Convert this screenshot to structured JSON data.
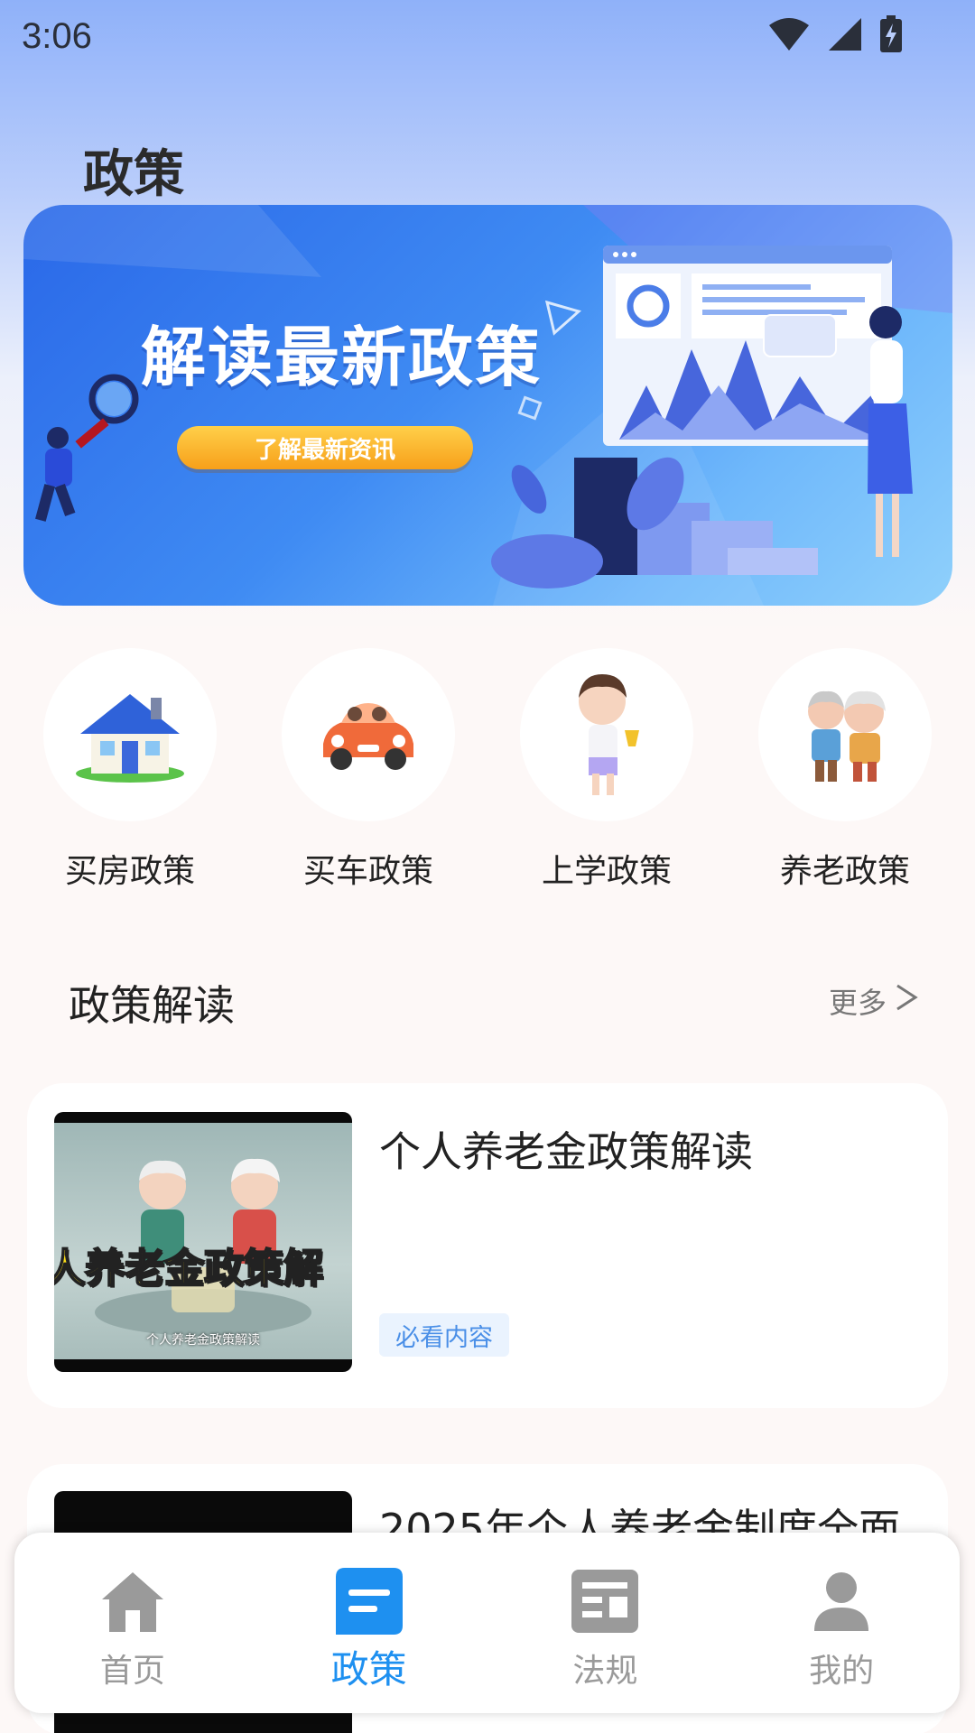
{
  "status_bar": {
    "time": "3:06"
  },
  "page": {
    "title": "政策"
  },
  "banner": {
    "title": "解读最新政策",
    "button_label": "了解最新资讯"
  },
  "categories": [
    {
      "label": "买房政策",
      "icon": "house-icon"
    },
    {
      "label": "买车政策",
      "icon": "car-icon"
    },
    {
      "label": "上学政策",
      "icon": "student-icon"
    },
    {
      "label": "养老政策",
      "icon": "elderly-couple-icon"
    }
  ],
  "section": {
    "title": "政策解读",
    "more_label": "更多"
  },
  "articles": [
    {
      "title": "个人养老金政策解读",
      "tag": "必看内容",
      "thumbnail_title": "人养老金政策解",
      "thumbnail_caption": "个人养老金政策解读"
    },
    {
      "title": "2025年个人养老金制度全面"
    }
  ],
  "bottom_nav": [
    {
      "label": "首页",
      "icon": "home-icon",
      "active": false
    },
    {
      "label": "政策",
      "icon": "policy-icon",
      "active": true
    },
    {
      "label": "法规",
      "icon": "regulation-icon",
      "active": false
    },
    {
      "label": "我的",
      "icon": "profile-icon",
      "active": false
    }
  ],
  "colors": {
    "accent": "#1e90f0",
    "inactive_nav": "#9a9a9a",
    "tag_bg": "#eaf3fe",
    "tag_text": "#4a8fe7",
    "banner_button": "#f7a01a"
  }
}
